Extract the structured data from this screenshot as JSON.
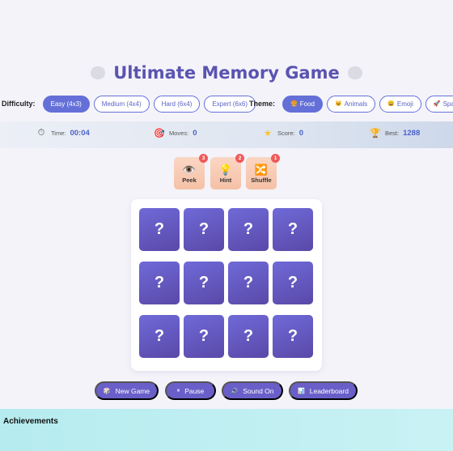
{
  "title": "Ultimate Memory Game",
  "difficulty": {
    "label": "Difficulty:",
    "options": [
      "Easy (4x3)",
      "Medium (4x4)",
      "Hard (6x4)",
      "Expert (6x6)"
    ],
    "selected": "Easy (4x3)"
  },
  "theme": {
    "label": "Theme:",
    "options": [
      {
        "label": "Food",
        "icon": "🍔"
      },
      {
        "label": "Animals",
        "icon": "🐱"
      },
      {
        "label": "Emoji",
        "icon": "😀"
      },
      {
        "label": "Space",
        "icon": "🚀"
      }
    ],
    "selected": "Food"
  },
  "stats": {
    "time_label": "Time:",
    "time_value": "00:04",
    "moves_label": "Moves:",
    "moves_value": "0",
    "score_label": "Score:",
    "score_value": "0",
    "best_label": "Best:",
    "best_value": "1288"
  },
  "powerups": [
    {
      "label": "Peek",
      "icon": "👁️",
      "count": "3"
    },
    {
      "label": "Hint",
      "icon": "💡",
      "count": "2"
    },
    {
      "label": "Shuffle",
      "icon": "🔀",
      "count": "1"
    }
  ],
  "cards": [
    "?",
    "?",
    "?",
    "?",
    "?",
    "?",
    "?",
    "?",
    "?",
    "?",
    "?",
    "?"
  ],
  "controls": [
    {
      "label": "New Game",
      "icon": "🎲"
    },
    {
      "label": "Pause",
      "icon": "⏸"
    },
    {
      "label": "Sound On",
      "icon": "🔊"
    },
    {
      "label": "Leaderboard",
      "icon": "📊"
    }
  ],
  "achievements": {
    "title": "Achievements"
  },
  "colors": {
    "accent": "#6470d8",
    "card": "#6a5fc8",
    "badge": "#ef5a5a"
  }
}
